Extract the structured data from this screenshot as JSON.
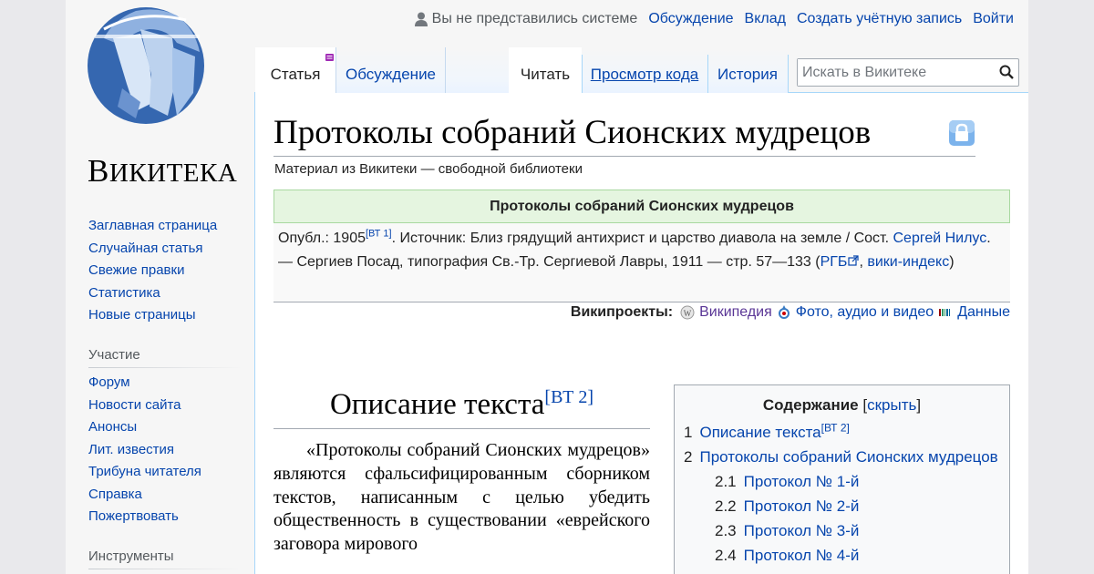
{
  "logo": {
    "wordmark_cap": "В",
    "wordmark_rest": "ИКИТЕКА"
  },
  "personal": {
    "anon": "Вы не представились системе",
    "talk": "Обсуждение",
    "contrib": "Вклад",
    "create": "Создать учётную запись",
    "login": "Войти"
  },
  "tabs": {
    "article": "Статья",
    "talk": "Обсуждение",
    "read": "Читать",
    "source": "Просмотр кода",
    "history": "История"
  },
  "search": {
    "placeholder": "Искать в Викитеке"
  },
  "page": {
    "title": "Протоколы собраний Сионских мудрецов",
    "tagline": "Материал из Викитеки — свободной библиотеки"
  },
  "header": {
    "work_title": "Протоколы собраний Сионских мудрецов",
    "published_label": "Опубл.: 1905",
    "published_ref": "[ВТ 1]",
    "source_text": ". Источник: Близ грядущий антихрист и царство диавола на земле / Сост. ",
    "author_link": "Сергей Нилус",
    "source_text2": ". — Сергиев Посад, типография Св.-Тр. Сергиевой Лавры, 1911 — стр. 57—133 (",
    "rgb_link": "РГБ",
    "wiki_index_link": "вики-индекс",
    "source_end": ")",
    "projects_label": "Википроекты:",
    "projects": [
      "Википедия",
      "Фото, аудио и видео",
      "Данные"
    ]
  },
  "section": {
    "heading": "Описание текста",
    "heading_ref": "[ВТ 2]",
    "body": "«Протоколы собраний Сионских мудрецов» являются сфальсифицированным сборником текстов, написанным с целью убедить общественность в существовании «еврейского заговора мирового"
  },
  "toc": {
    "title": "Содержание",
    "toggle_open": "[",
    "toggle": "скрыть",
    "toggle_close": "]",
    "items": [
      {
        "num": "1",
        "label": "Описание текста",
        "ref": "[ВТ 2]"
      },
      {
        "num": "2",
        "label": "Протоколы собраний Сионских мудрецов"
      },
      {
        "num": "2.1",
        "label": "Протокол № 1-й"
      },
      {
        "num": "2.2",
        "label": "Протокол № 2-й"
      },
      {
        "num": "2.3",
        "label": "Протокол № 3-й"
      },
      {
        "num": "2.4",
        "label": "Протокол № 4-й"
      }
    ]
  },
  "sidebar": {
    "nav": [
      "Заглавная страница",
      "Случайная статья",
      "Свежие правки",
      "Статистика",
      "Новые страницы"
    ],
    "participation_heading": "Участие",
    "participation": [
      "Форум",
      "Новости сайта",
      "Анонсы",
      "Лит. известия",
      "Трибуна читателя",
      "Справка",
      "Пожертвовать"
    ],
    "tools_heading": "Инструменты"
  },
  "colors": {
    "link": "#0645ad",
    "header_green": "#e5f5e0",
    "tab_border": "#a7d7f9",
    "logo_blue": "#3c6bb3"
  }
}
